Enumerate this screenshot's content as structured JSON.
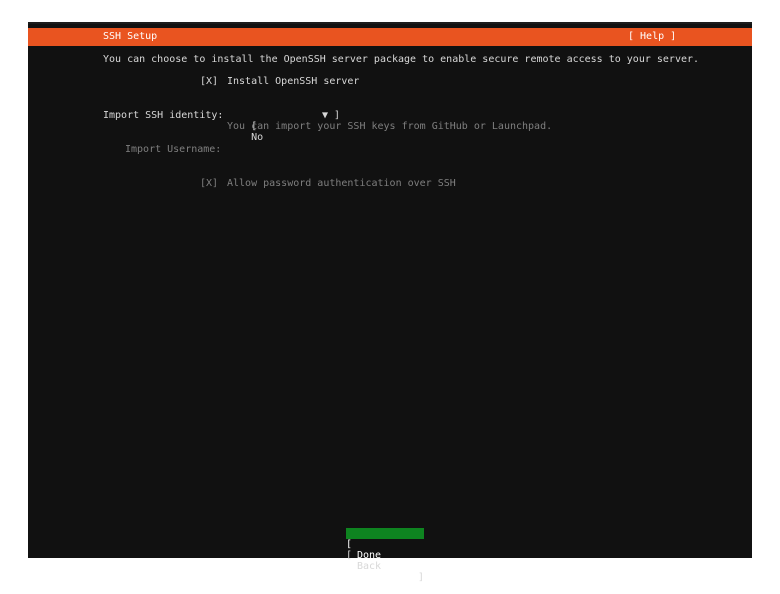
{
  "header": {
    "title": "SSH Setup",
    "help": "[ Help ]"
  },
  "intro": "You can choose to install the OpenSSH server package to enable secure remote access to your server.",
  "install_openssh": {
    "checkbox": "[X]",
    "label": "Install OpenSSH server"
  },
  "import_identity": {
    "label": "Import SSH identity:",
    "select_open": "[",
    "selected": "No",
    "select_close": "▼ ]",
    "hint": "You can import your SSH keys from GitHub or Launchpad."
  },
  "import_username": {
    "label": "Import Username:",
    "value": ""
  },
  "allow_password": {
    "checkbox": "[X]",
    "label": "Allow password authentication over SSH"
  },
  "buttons": {
    "done": {
      "open": "[",
      "label": "Done",
      "close": "]"
    },
    "back": {
      "open": "[",
      "label": "Back",
      "close": "]"
    }
  },
  "colors": {
    "accent": "#e95420",
    "done_bg": "#0e8420",
    "background": "#111111"
  }
}
